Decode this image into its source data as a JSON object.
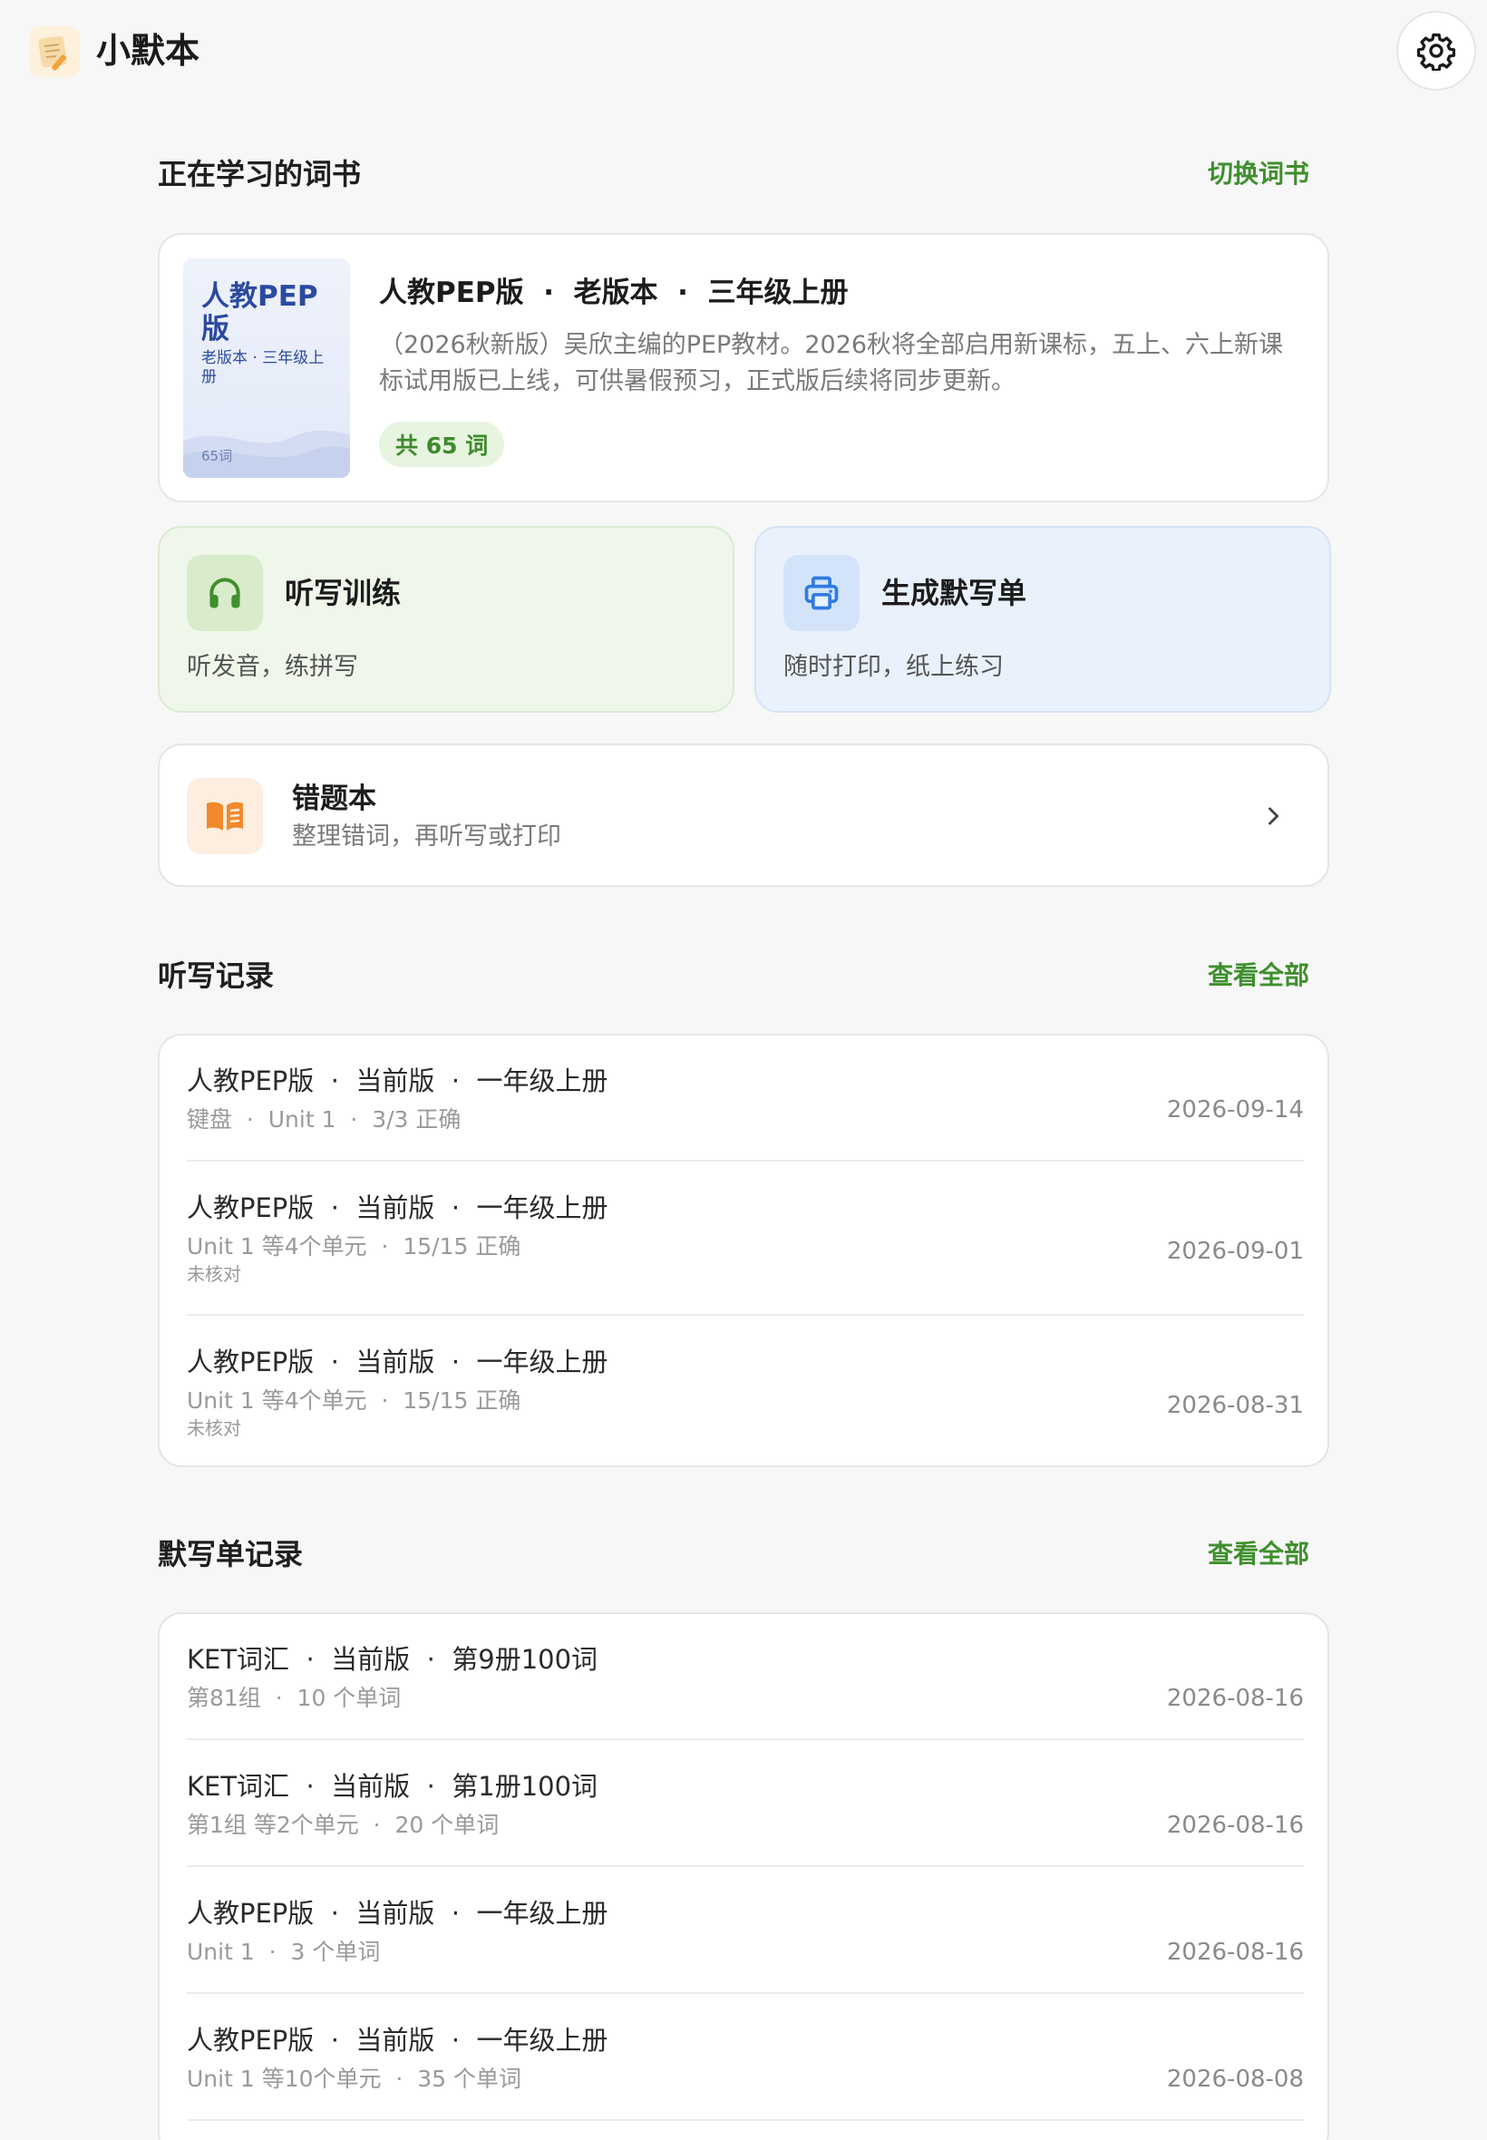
{
  "header": {
    "app_title": "小默本",
    "logo_icon": "notebook-pencil-icon",
    "settings_icon": "gear-icon"
  },
  "current_book_section": {
    "title": "正在学习的词书",
    "switch_label": "切换词书"
  },
  "book": {
    "cover_title": "人教PEP版",
    "cover_subtitle": "老版本 · 三年级上册",
    "cover_word_count": "65词",
    "name": "人教PEP版  ·  老版本  ·  三年级上册",
    "description": "（2026秋新版）吴欣主编的PEP教材。2026秋将全部启用新课标，五上、六上新课标试用版已上线，可供暑假预习，正式版后续将同步更新。",
    "badge": "共 65 词"
  },
  "features": {
    "dictation": {
      "title": "听写训练",
      "subtitle": "听发音，练拼写",
      "icon": "headphones-icon"
    },
    "print": {
      "title": "生成默写单",
      "subtitle": "随时打印，纸上练习",
      "icon": "printer-icon"
    }
  },
  "mistakes": {
    "title": "错题本",
    "subtitle": "整理错词，再听写或打印",
    "icon": "open-book-icon"
  },
  "dictation_records": {
    "title": "听写记录",
    "view_all": "查看全部",
    "items": [
      {
        "title": "人教PEP版  ·  当前版  ·  一年级上册",
        "meta": "键盘  ·  Unit 1  ·  3/3 正确",
        "note": "",
        "date": "2026-09-14"
      },
      {
        "title": "人教PEP版  ·  当前版  ·  一年级上册",
        "meta": "Unit 1 等4个单元  ·  15/15 正确",
        "note": "未核对",
        "date": "2026-09-01"
      },
      {
        "title": "人教PEP版  ·  当前版  ·  一年级上册",
        "meta": "Unit 1 等4个单元  ·  15/15 正确",
        "note": "未核对",
        "date": "2026-08-31"
      }
    ]
  },
  "sheet_records": {
    "title": "默写单记录",
    "view_all": "查看全部",
    "items": [
      {
        "title": "KET词汇  ·  当前版  ·  第9册100词",
        "meta": "第81组  ·  10 个单词",
        "date": "2026-08-16"
      },
      {
        "title": "KET词汇  ·  当前版  ·  第1册100词",
        "meta": "第1组 等2个单元  ·  20 个单词",
        "date": "2026-08-16"
      },
      {
        "title": "人教PEP版  ·  当前版  ·  一年级上册",
        "meta": "Unit 1  ·  3 个单词",
        "date": "2026-08-16"
      },
      {
        "title": "人教PEP版  ·  当前版  ·  一年级上册",
        "meta": "Unit 1 等10个单元  ·  35 个单词",
        "date": "2026-08-08"
      }
    ]
  },
  "colors": {
    "accent_green": "#3f8f2e",
    "dictation_bg": "#eff7ea",
    "print_bg": "#e9f1fd",
    "mistakes_accent": "#f08a2c",
    "print_accent": "#2f7be0"
  }
}
